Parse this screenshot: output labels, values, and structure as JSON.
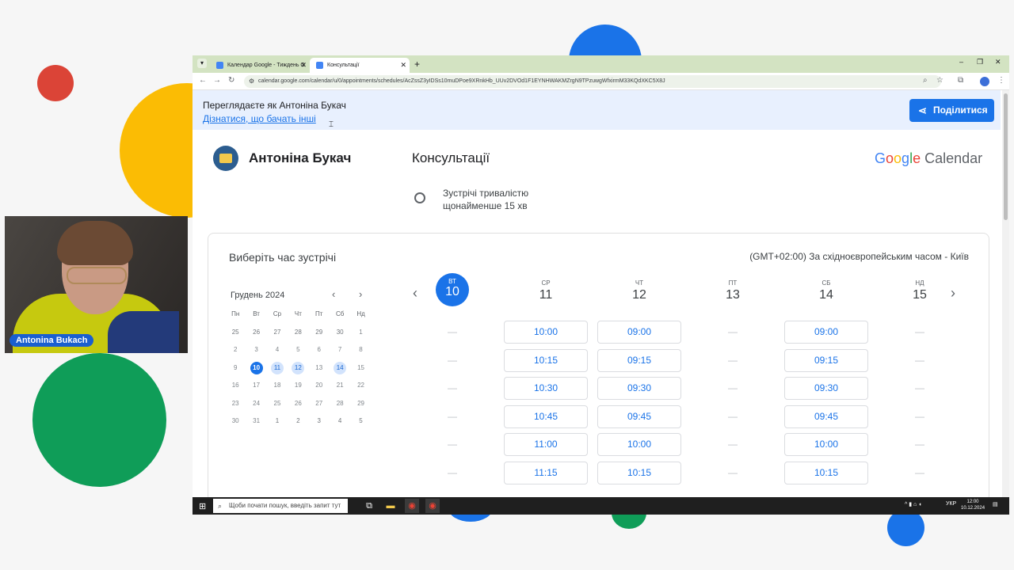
{
  "webcam": {
    "label": "Antonina Bukach"
  },
  "browser": {
    "tabs": [
      {
        "title": "Календар Google - Тиждень О",
        "close": "✕"
      },
      {
        "title": "Консультації",
        "close": "✕"
      }
    ],
    "new_tab": "+",
    "controls": {
      "minimize": "–",
      "maximize": "❐",
      "close": "✕"
    },
    "url": "calendar.google.com/calendar/u/0/appointments/schedules/AcZssZ3yIDSs10muDPoe9XRnkHb_UUv2DVOd1F1EYNHWAKMZrgN9TPzuwgWfxirmM33KQdXKC5X8J",
    "nav": {
      "back": "←",
      "forward": "→",
      "reload": "↻"
    }
  },
  "banner": {
    "viewing_as": "Переглядаєте як Антоніна Букач",
    "link": "Дізнатися, що бачать інші",
    "share_button": "Поділитися"
  },
  "booking": {
    "host_name": "Антоніна Букач",
    "event_title": "Консультації",
    "brand_google": [
      "G",
      "o",
      "o",
      "g",
      "l",
      "e"
    ],
    "brand_calendar": "Calendar",
    "duration_line1": "Зустрічі тривалістю",
    "duration_line2": "щонайменше 15 хв",
    "pick_time": "Виберіть час зустрічі",
    "timezone": "(GMT+02:00) За східноєвропейським часом - Київ"
  },
  "mini_calendar": {
    "month": "Грудень 2024",
    "prev": "‹",
    "next": "›",
    "weekdays": [
      "Пн",
      "Вт",
      "Ср",
      "Чт",
      "Пт",
      "Сб",
      "Нд"
    ],
    "weeks": [
      [
        "25",
        "26",
        "27",
        "28",
        "29",
        "30",
        "1"
      ],
      [
        "2",
        "3",
        "4",
        "5",
        "6",
        "7",
        "8"
      ],
      [
        "9",
        "10",
        "11",
        "12",
        "13",
        "14",
        "15"
      ],
      [
        "16",
        "17",
        "18",
        "19",
        "20",
        "21",
        "22"
      ],
      [
        "23",
        "24",
        "25",
        "26",
        "27",
        "28",
        "29"
      ],
      [
        "30",
        "31",
        "1",
        "2",
        "3",
        "4",
        "5"
      ]
    ],
    "today": "10",
    "available": [
      "11",
      "12",
      "14"
    ]
  },
  "week": {
    "prev": "‹",
    "next": "›",
    "days": [
      {
        "name": "ВТ",
        "date": "10",
        "selected": true,
        "slots": []
      },
      {
        "name": "СР",
        "date": "11",
        "selected": false,
        "slots": [
          "10:00",
          "10:15",
          "10:30",
          "10:45",
          "11:00",
          "11:15"
        ]
      },
      {
        "name": "ЧТ",
        "date": "12",
        "selected": false,
        "slots": [
          "09:00",
          "09:15",
          "09:30",
          "09:45",
          "10:00",
          "10:15"
        ]
      },
      {
        "name": "ПТ",
        "date": "13",
        "selected": false,
        "slots": []
      },
      {
        "name": "СБ",
        "date": "14",
        "selected": false,
        "slots": [
          "09:00",
          "09:15",
          "09:30",
          "09:45",
          "10:00",
          "10:15"
        ]
      },
      {
        "name": "НД",
        "date": "15",
        "selected": false,
        "slots": []
      }
    ],
    "empty_marker": "—"
  },
  "taskbar": {
    "search_placeholder": "Щоби почати пошук, введіть запит тут",
    "lang": "УКР",
    "time": "12:00",
    "date": "10.12.2024"
  },
  "colors": {
    "accent": "#1a73e8",
    "available_day": "#d2e3fc",
    "banner_bg": "#e8f0fe"
  }
}
